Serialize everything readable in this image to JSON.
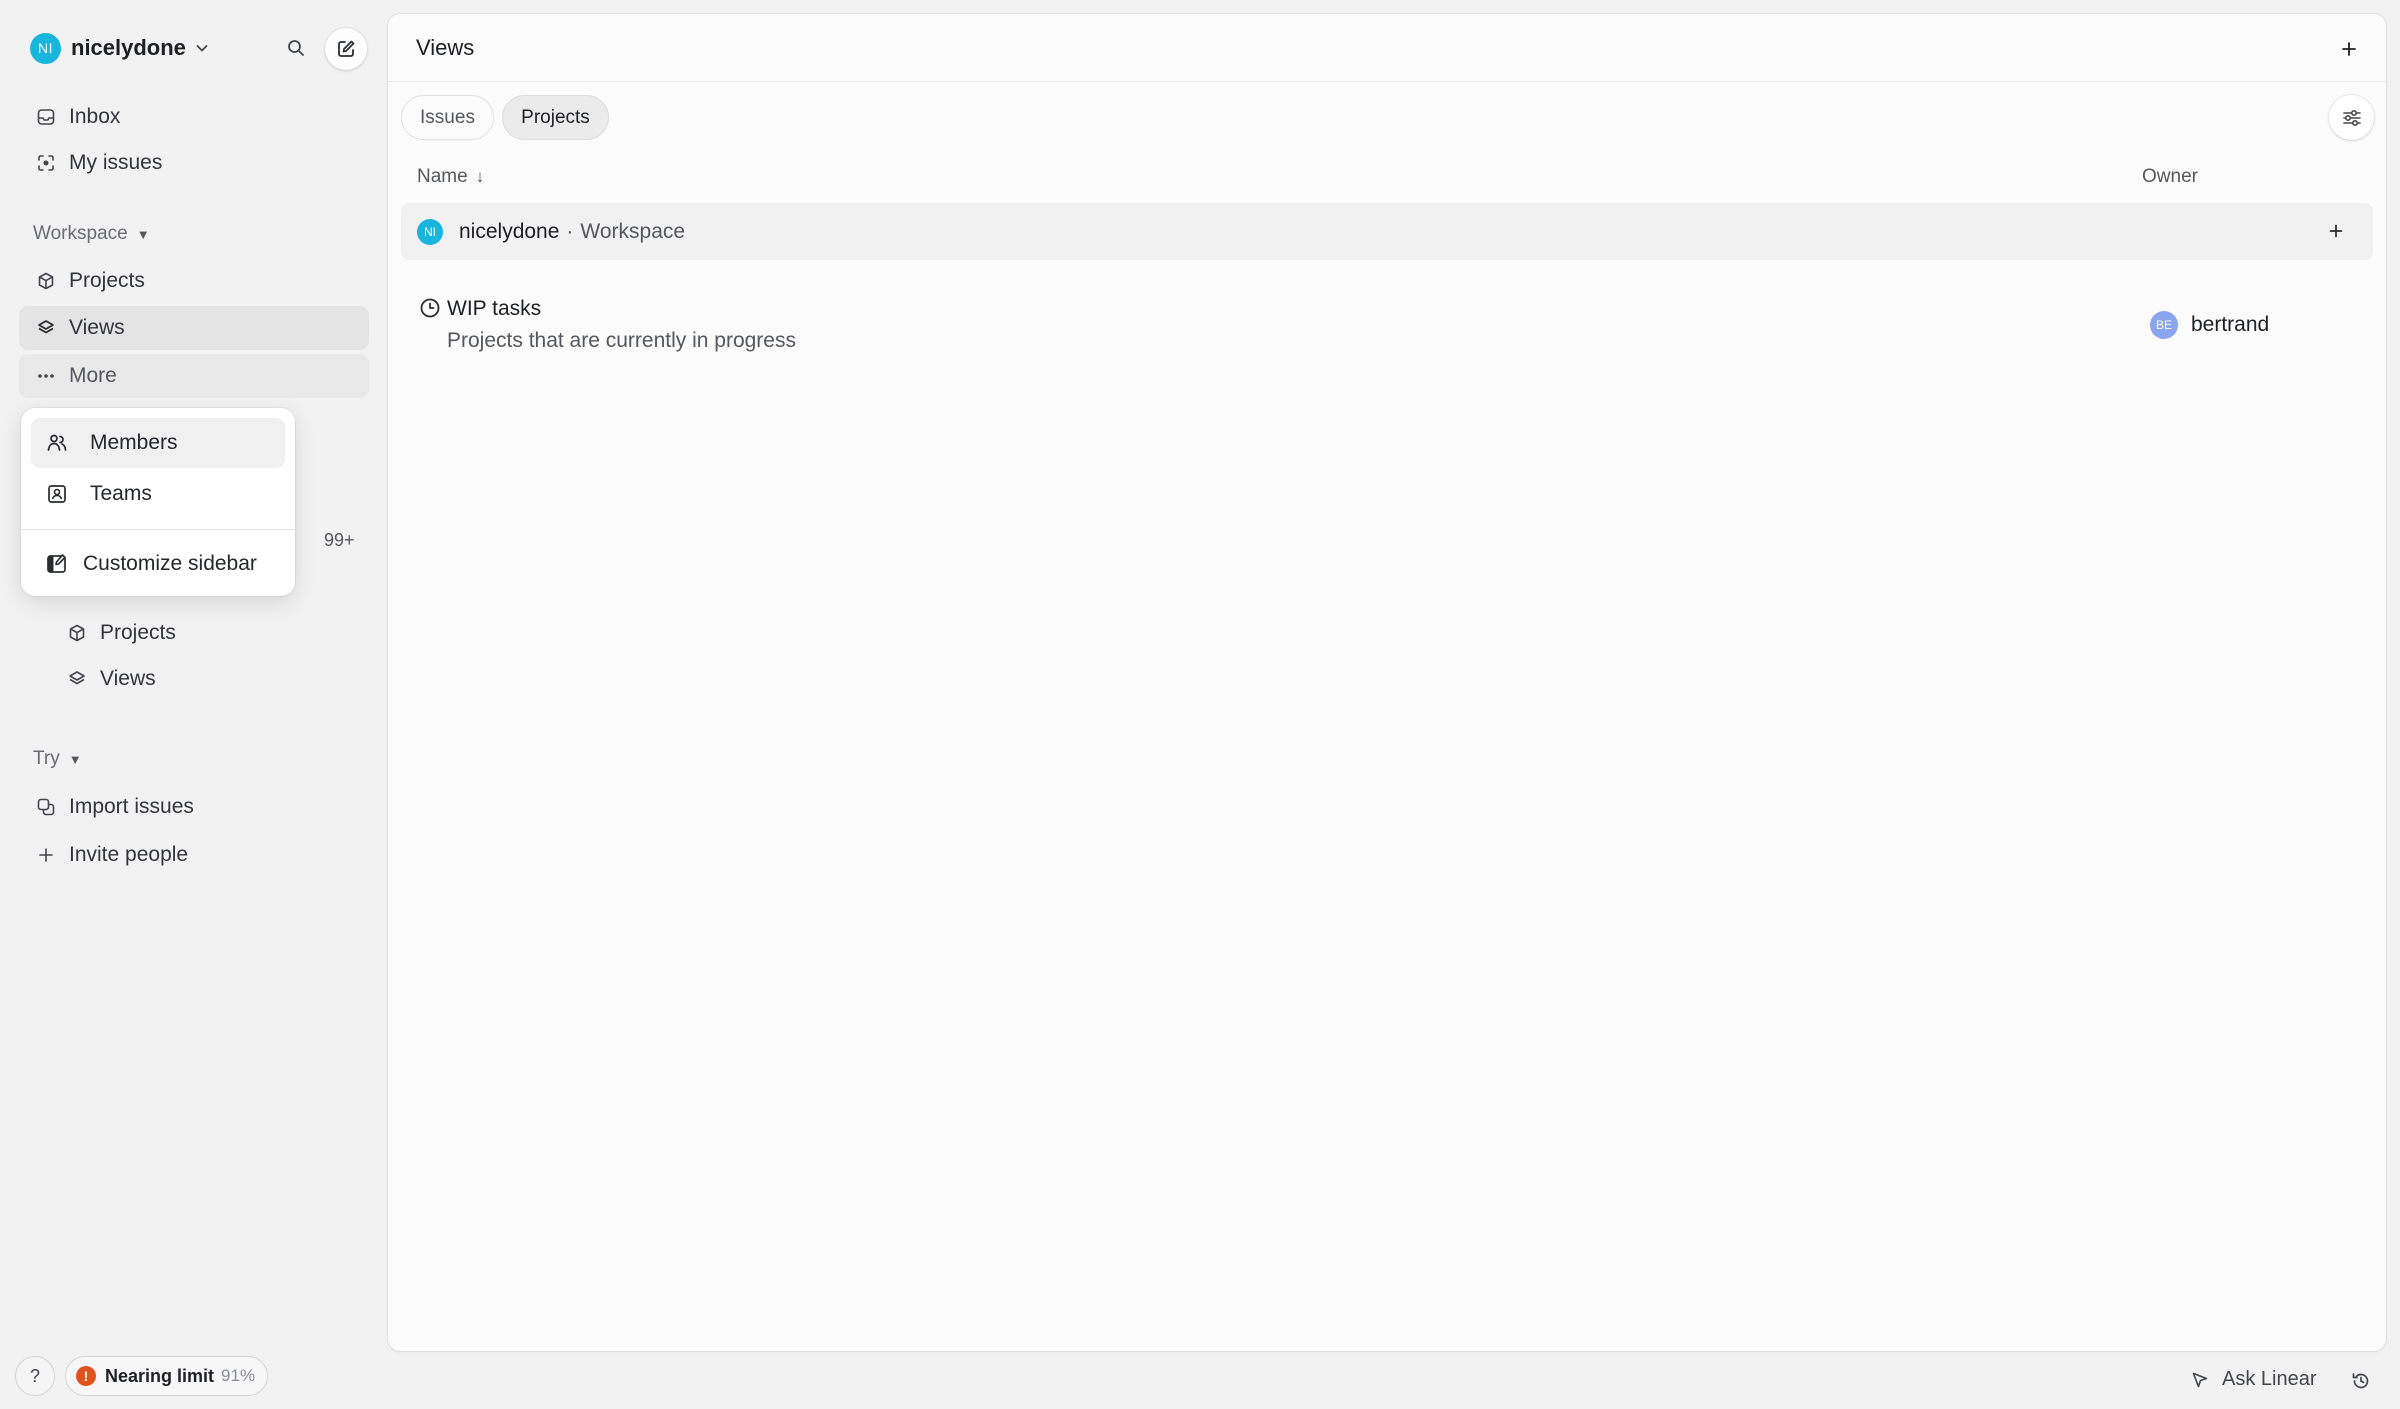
{
  "workspace": {
    "avatar_initials": "NI",
    "name": "nicelydone",
    "avatar_color": "#18b5dc"
  },
  "sidebar": {
    "top_items": [
      {
        "label": "Inbox",
        "icon": "inbox-icon"
      },
      {
        "label": "My issues",
        "icon": "my-issues-icon"
      }
    ],
    "workspace_section": {
      "label": "Workspace",
      "items": [
        {
          "label": "Projects",
          "icon": "cube-icon"
        },
        {
          "label": "Views",
          "icon": "layers-icon",
          "active": true
        },
        {
          "label": "More",
          "icon": "ellipsis-icon"
        }
      ]
    },
    "count_badge": "99+",
    "team_items": [
      {
        "label": "Projects",
        "icon": "cube-icon"
      },
      {
        "label": "Views",
        "icon": "layers-icon"
      }
    ],
    "try_section": {
      "label": "Try",
      "items": [
        {
          "label": "Import issues",
          "icon": "import-icon"
        },
        {
          "label": "Invite people",
          "icon": "plus-icon"
        }
      ]
    }
  },
  "more_menu": {
    "items": [
      {
        "label": "Members",
        "icon": "members-icon",
        "highlighted": true
      },
      {
        "label": "Teams",
        "icon": "teams-icon"
      }
    ],
    "footer": {
      "label": "Customize sidebar",
      "icon": "customize-icon"
    }
  },
  "bottom_bar": {
    "help_label": "?",
    "limit_icon": "!",
    "limit_label": "Nearing limit",
    "limit_percent": "91%",
    "limit_color": "#e0531f",
    "ask_label": "Ask Linear"
  },
  "main": {
    "title": "Views",
    "tabs": [
      {
        "label": "Issues",
        "active": false
      },
      {
        "label": "Projects",
        "active": true
      }
    ],
    "columns": {
      "name": "Name",
      "sort_arrow": "↓",
      "owner": "Owner"
    },
    "group": {
      "avatar_initials": "NI",
      "name": "nicelydone",
      "separator": "·",
      "subtitle": "Workspace"
    },
    "views": [
      {
        "title": "WIP tasks",
        "description": "Projects that are currently in progress",
        "icon": "clock-icon",
        "owner": {
          "initials": "BE",
          "name": "bertrand",
          "color": "#8aa4ee"
        }
      }
    ]
  }
}
